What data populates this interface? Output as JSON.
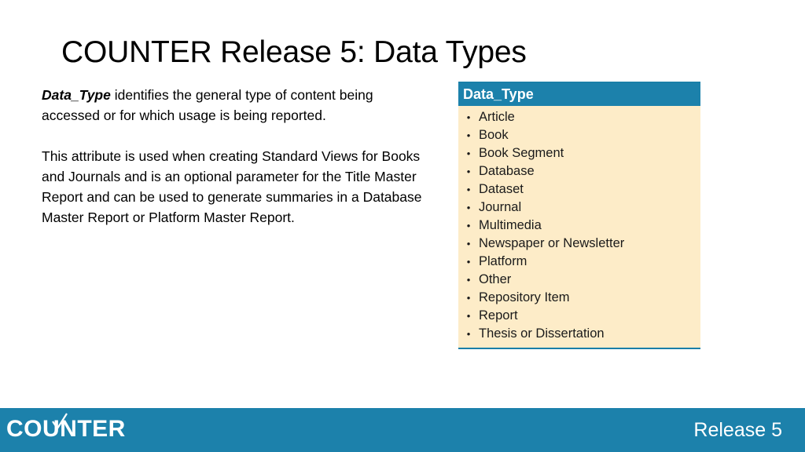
{
  "slide": {
    "title": "COUNTER Release 5: Data Types",
    "body": {
      "lead_bold": "Data_Type",
      "paragraph1_rest": " identifies the general type of content being accessed or for which usage is being reported.",
      "paragraph2": "This attribute is used when creating Standard Views for Books and Journals and is an optional parameter for the Title Master Report and can be used to generate summaries in a Database Master Report or Platform Master Report."
    },
    "table": {
      "header": "Data_Type",
      "bullet_glyph": "•",
      "items": [
        "Article",
        "Book",
        "Book Segment",
        "Database",
        "Dataset",
        "Journal",
        "Multimedia",
        "Newspaper or Newsletter",
        "Platform",
        "Other",
        "Repository Item",
        "Report",
        "Thesis or Dissertation"
      ]
    }
  },
  "footer": {
    "logo_text": "COUNTER",
    "release_label": "Release 5",
    "accent_color": "#1c81ab",
    "table_body_color": "#fdecc8"
  }
}
